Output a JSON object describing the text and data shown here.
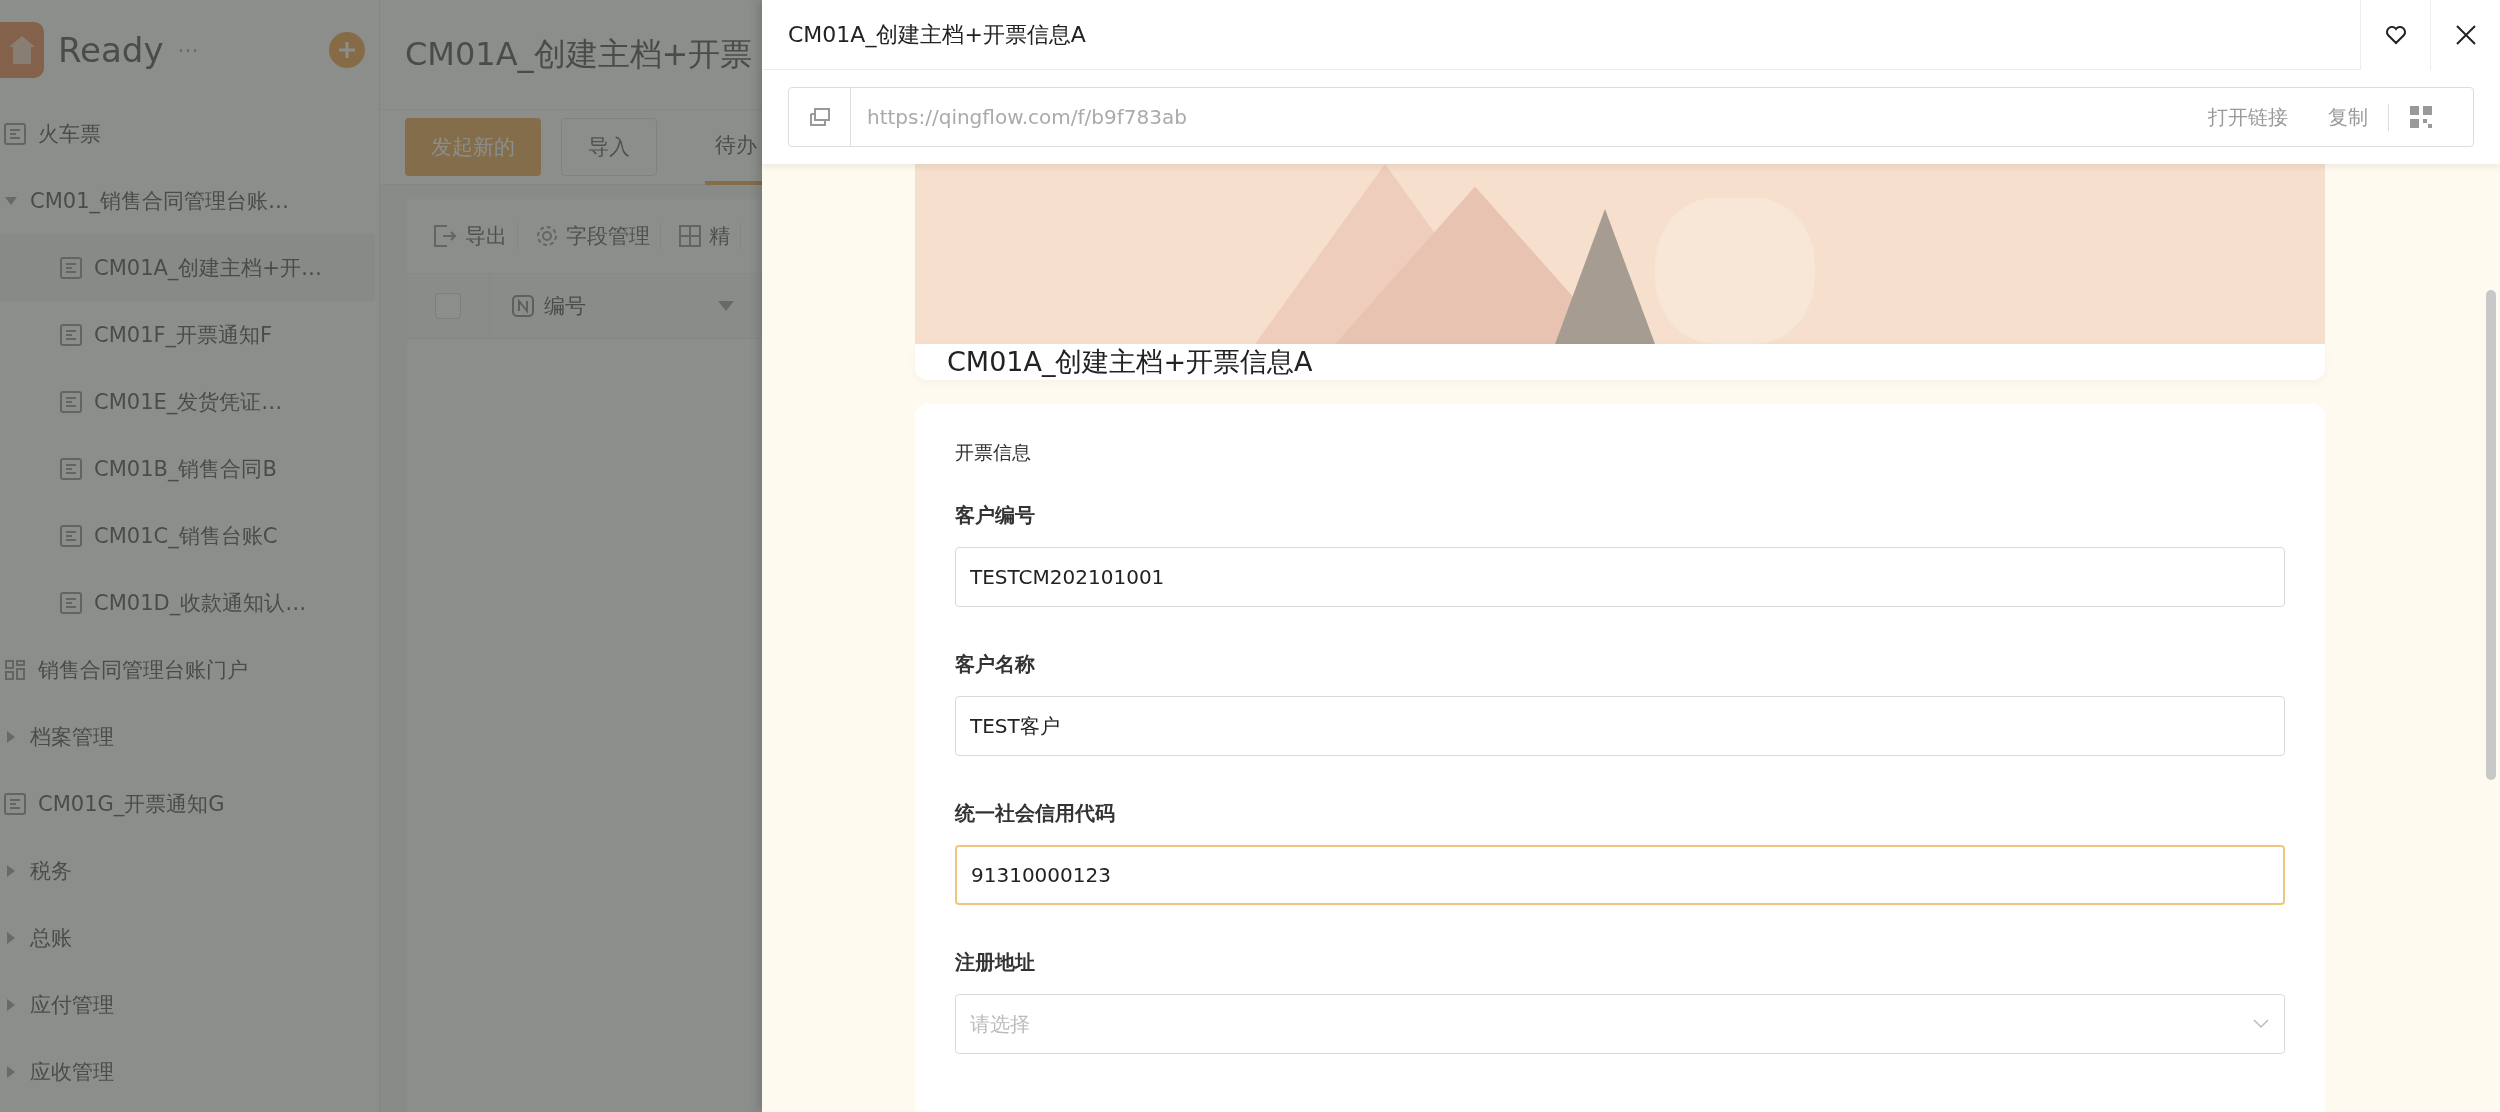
{
  "sidebar": {
    "app_name": "Ready",
    "more": "···",
    "items": [
      {
        "kind": "form",
        "label": "火车票"
      },
      {
        "kind": "group",
        "label": "CM01_销售合同管理台账…",
        "expanded": true,
        "children": [
          {
            "kind": "form",
            "label": "CM01A_创建主档+开…",
            "selected": true
          },
          {
            "kind": "form",
            "label": "CM01F_开票通知F",
            "selected": false
          },
          {
            "kind": "form",
            "label": "CM01E_发货凭证…",
            "selected": false
          },
          {
            "kind": "form",
            "label": "CM01B_销售合同B",
            "selected": false
          },
          {
            "kind": "form",
            "label": "CM01C_销售台账C",
            "selected": false
          },
          {
            "kind": "form",
            "label": "CM01D_收款通知认…",
            "selected": false
          }
        ]
      },
      {
        "kind": "portal",
        "label": "销售合同管理台账门户"
      },
      {
        "kind": "group",
        "label": "档案管理",
        "expanded": false
      },
      {
        "kind": "form",
        "label": "CM01G_开票通知G"
      },
      {
        "kind": "group",
        "label": "税务",
        "expanded": false
      },
      {
        "kind": "group",
        "label": "总账",
        "expanded": false
      },
      {
        "kind": "group",
        "label": "应付管理",
        "expanded": false
      },
      {
        "kind": "group",
        "label": "应收管理",
        "expanded": false
      }
    ]
  },
  "main": {
    "title": "CM01A_创建主档+开票",
    "primary_button": "发起新的",
    "import_button": "导入",
    "tabs": [
      {
        "label": "待办",
        "selected": true
      }
    ],
    "toolbar": [
      "导出",
      "字段管理",
      "精"
    ],
    "table": {
      "select_all_checked": false,
      "columns": [
        "编号"
      ]
    }
  },
  "drawer": {
    "title": "CM01A_创建主档+开票信息A",
    "url": "https://qingflow.com/f/b9f783ab",
    "open_link": "打开链接",
    "copy": "复制",
    "form_title": "CM01A_创建主档+开票信息A",
    "section": "开票信息",
    "fields": [
      {
        "kind": "text",
        "label": "客户编号",
        "value": "TESTCM202101001",
        "focused": false
      },
      {
        "kind": "text",
        "label": "客户名称",
        "value": "TEST客户",
        "focused": false
      },
      {
        "kind": "text",
        "label": "统一社会信用代码",
        "value": "91310000123",
        "focused": true
      },
      {
        "kind": "select",
        "label": "注册地址",
        "placeholder": "请选择",
        "focused": false
      }
    ]
  }
}
